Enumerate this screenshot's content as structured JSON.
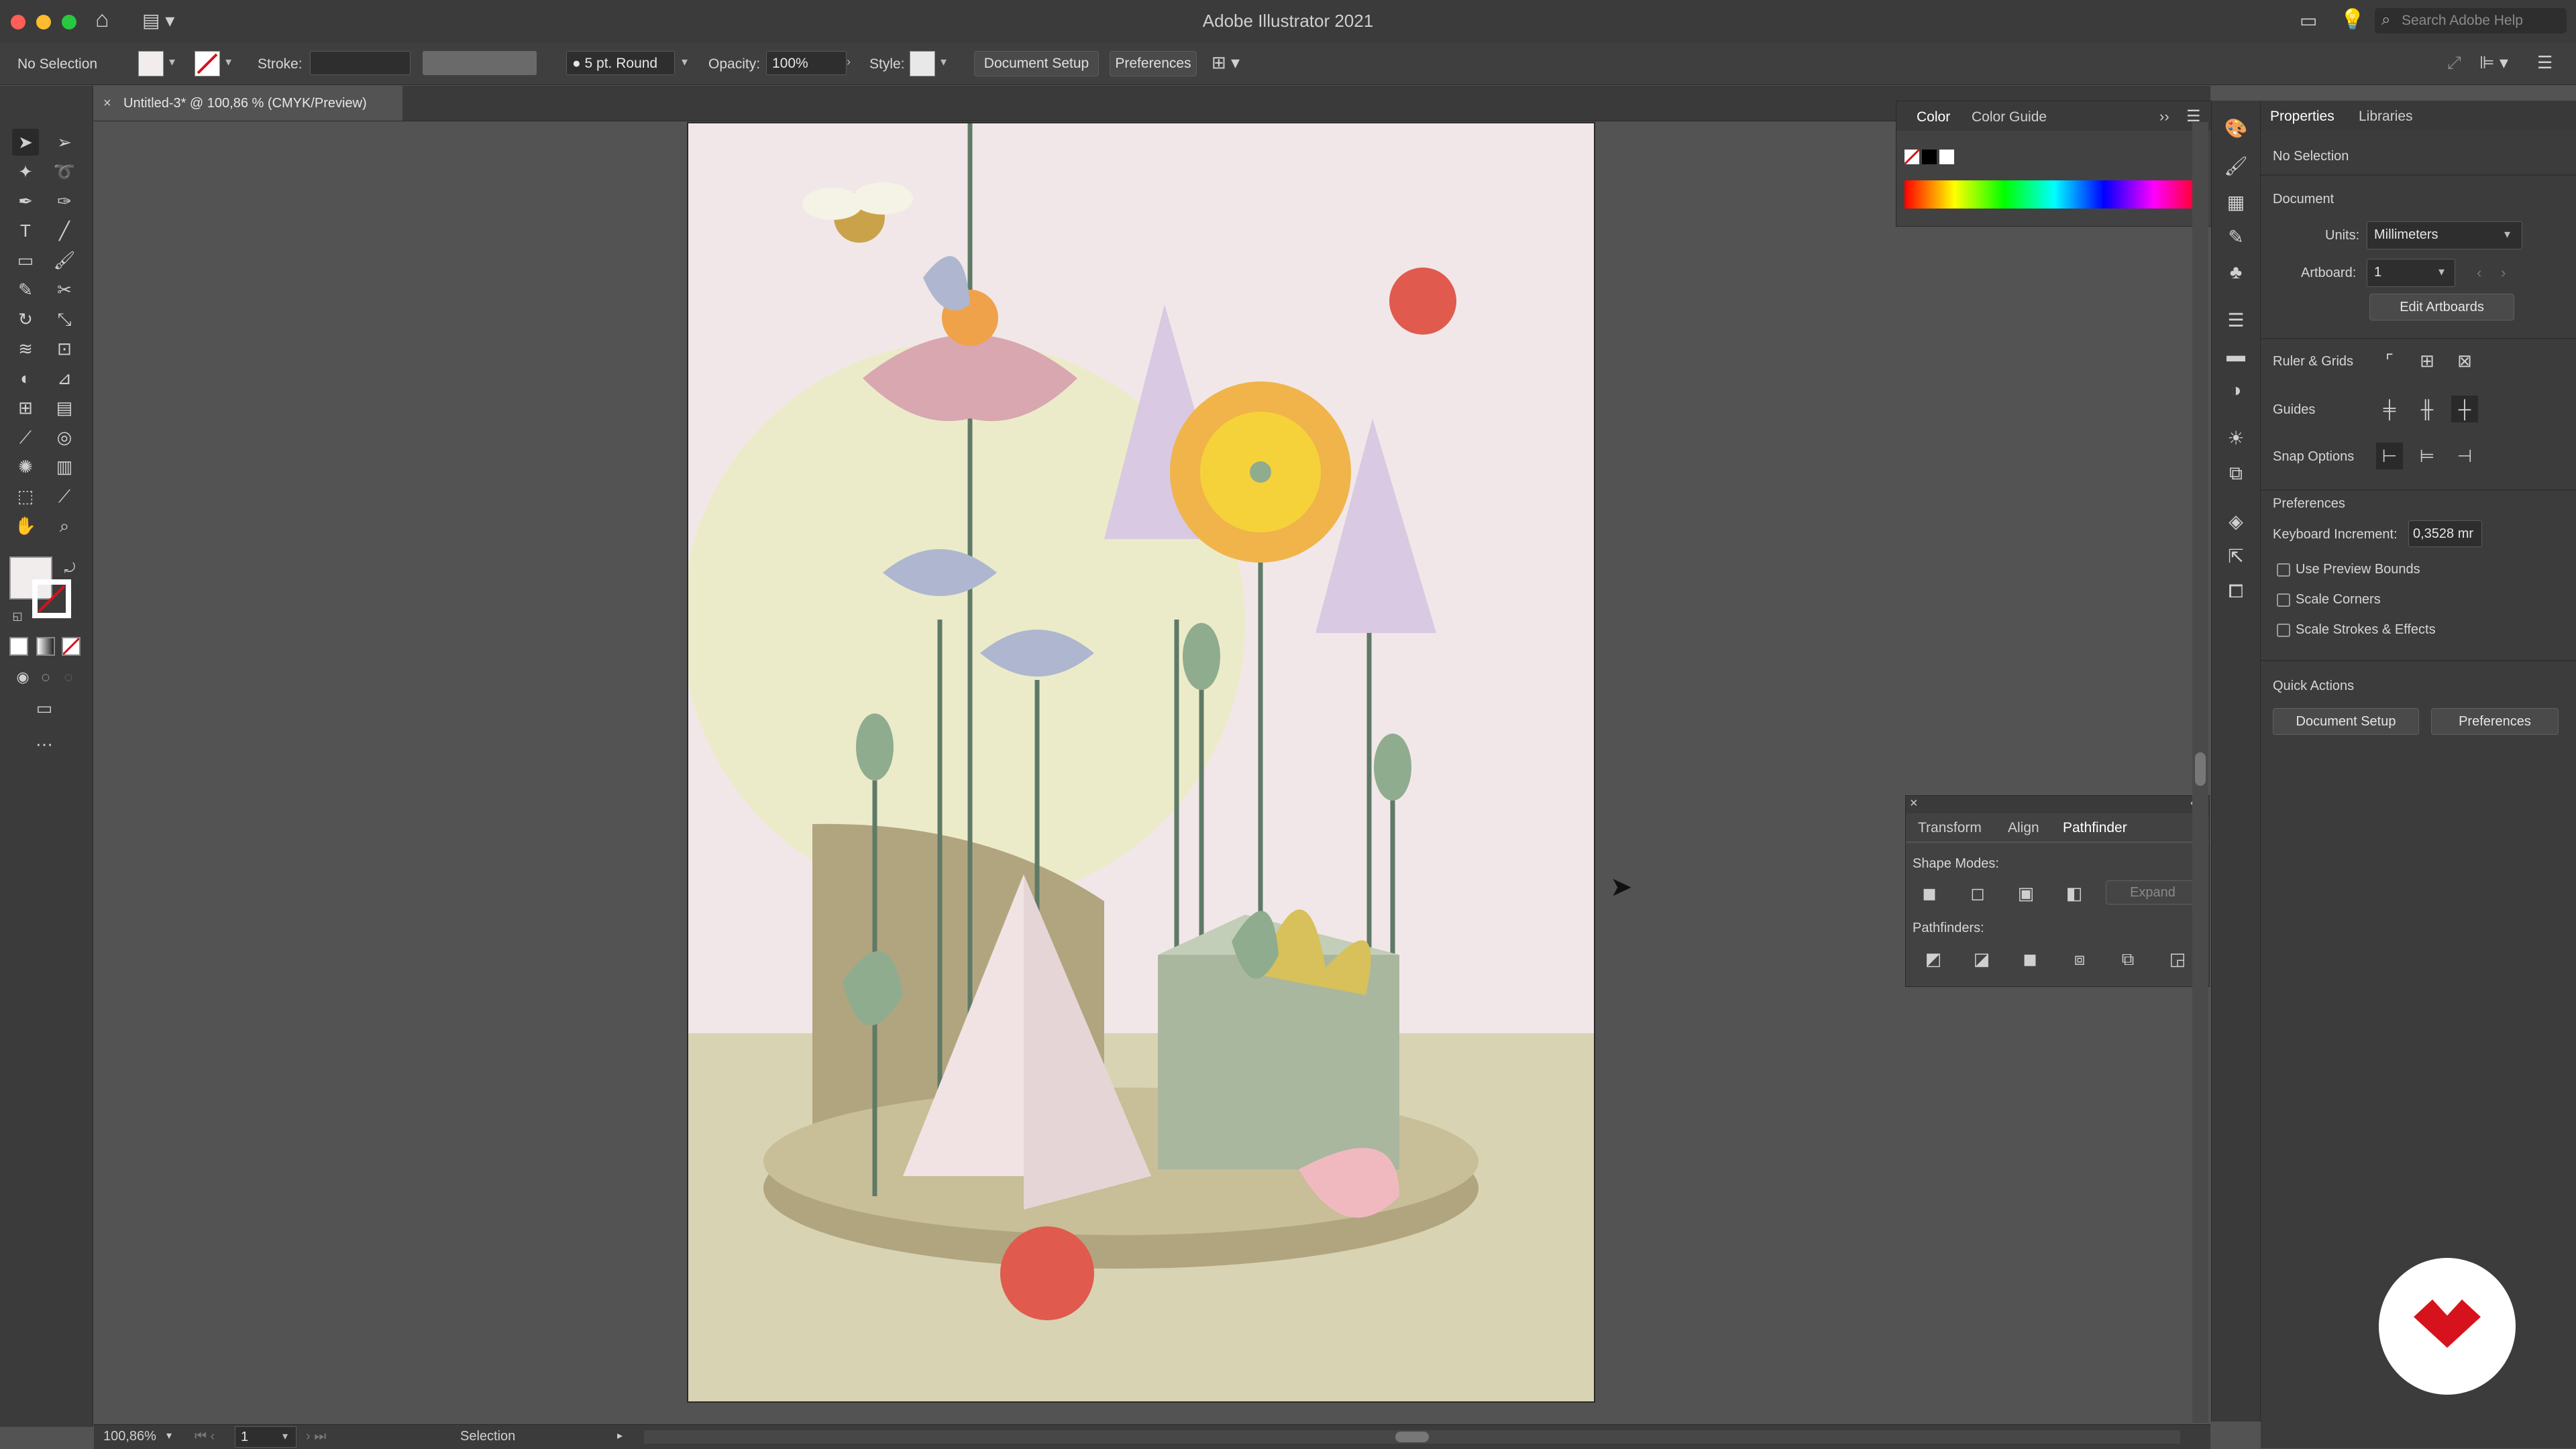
{
  "window": {
    "title": "Adobe Illustrator 2021",
    "search_placeholder": "Search Adobe Help"
  },
  "control_bar": {
    "selection_label": "No Selection",
    "stroke_label": "Stroke:",
    "brush_value": "5 pt. Round",
    "opacity_label": "Opacity:",
    "opacity_value": "100%",
    "style_label": "Style:",
    "document_setup": "Document Setup",
    "preferences": "Preferences"
  },
  "document_tab": {
    "title": "Untitled-3* @ 100,86 % (CMYK/Preview)"
  },
  "status_bar": {
    "zoom": "100,86%",
    "artboard": "1",
    "tool": "Selection"
  },
  "color_panel": {
    "tabs": [
      "Color",
      "Color Guide"
    ]
  },
  "pathfinder_panel": {
    "tabs": [
      "Transform",
      "Align",
      "Pathfinder"
    ],
    "shape_modes_label": "Shape Modes:",
    "expand_label": "Expand",
    "pathfinders_label": "Pathfinders:"
  },
  "properties": {
    "tabs": [
      "Properties",
      "Libraries"
    ],
    "selection": "No Selection",
    "document_heading": "Document",
    "units_label": "Units:",
    "units_value": "Millimeters",
    "artboard_label": "Artboard:",
    "artboard_value": "1",
    "edit_artboards": "Edit Artboards",
    "ruler_grids": "Ruler & Grids",
    "guides": "Guides",
    "snap_options": "Snap Options",
    "preferences_heading": "Preferences",
    "keyboard_increment_label": "Keyboard Increment:",
    "keyboard_increment_value": "0,3528 mr",
    "checkboxes": [
      "Use Preview Bounds",
      "Scale Corners",
      "Scale Strokes & Effects"
    ],
    "quick_actions": "Quick Actions",
    "qa_document_setup": "Document Setup",
    "qa_preferences": "Preferences"
  },
  "colors": {
    "accent": "#d6131c",
    "canvas_bg": "#535353",
    "artboard_bg": "#f1e7e8"
  }
}
